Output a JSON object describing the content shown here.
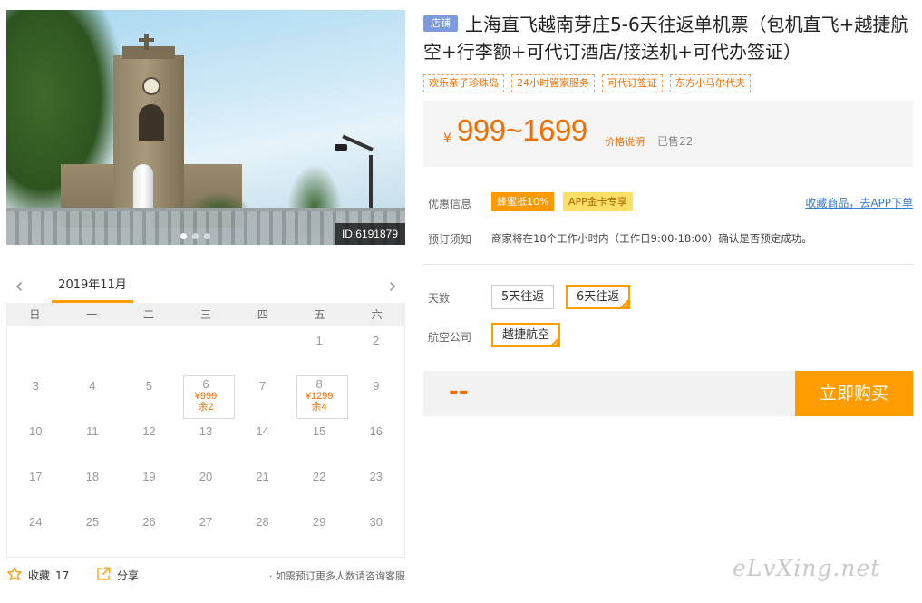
{
  "photo": {
    "id_label": "ID:6191879",
    "dots": 3,
    "active_dot": 0
  },
  "calendar": {
    "month": "2019年11月",
    "prev_icon": "chevron-left-icon",
    "next_icon": "chevron-right-icon",
    "weekdays": [
      "日",
      "一",
      "二",
      "三",
      "四",
      "五",
      "六"
    ],
    "weeks": [
      [
        {
          "d": ""
        },
        {
          "d": ""
        },
        {
          "d": ""
        },
        {
          "d": ""
        },
        {
          "d": ""
        },
        {
          "d": "1"
        },
        {
          "d": "2"
        }
      ],
      [
        {
          "d": "3"
        },
        {
          "d": "4"
        },
        {
          "d": "5"
        },
        {
          "d": "6",
          "price": "¥999",
          "stock": "余2"
        },
        {
          "d": "7"
        },
        {
          "d": "8",
          "price": "¥1299",
          "stock": "余4"
        },
        {
          "d": "9"
        }
      ],
      [
        {
          "d": "10"
        },
        {
          "d": "11"
        },
        {
          "d": "12"
        },
        {
          "d": "13"
        },
        {
          "d": "14"
        },
        {
          "d": "15"
        },
        {
          "d": "16"
        }
      ],
      [
        {
          "d": "17"
        },
        {
          "d": "18"
        },
        {
          "d": "19"
        },
        {
          "d": "20"
        },
        {
          "d": "21"
        },
        {
          "d": "22"
        },
        {
          "d": "23"
        }
      ],
      [
        {
          "d": "24"
        },
        {
          "d": "25"
        },
        {
          "d": "26"
        },
        {
          "d": "27"
        },
        {
          "d": "28"
        },
        {
          "d": "29"
        },
        {
          "d": "30"
        }
      ]
    ]
  },
  "footer": {
    "favorite_label": "收藏",
    "favorite_count": "17",
    "share_label": "分享",
    "consult_text": "· 如需预订更多人数请咨询客服"
  },
  "product": {
    "shop_tag": "店铺",
    "title": "上海直飞越南芽庄5-6天往返单机票（包机直飞+越捷航空+行李额+可代订酒店/接送机+可代办签证）",
    "tags": [
      "欢乐亲子珍珠岛",
      "24小时管家服务",
      "可代订签证",
      "东方小马尔代夫"
    ]
  },
  "price": {
    "currency": "¥",
    "value": "999~1699",
    "note": "价格说明",
    "sold": "已售22"
  },
  "promo": {
    "label": "优惠信息",
    "badge1": "蜂蜜抵10%",
    "badge2": "APP金卡专享",
    "app_link": "收藏商品，去APP下单"
  },
  "notice": {
    "label": "预订须知",
    "text": "商家将在18个工作小时内（工作日9:00-18:00）确认是否预定成功。"
  },
  "options": {
    "days_label": "天数",
    "days": [
      "5天往返",
      "6天往返"
    ],
    "days_selected": 1,
    "airline_label": "航空公司",
    "airlines": [
      "越捷航空"
    ],
    "airline_selected": 0
  },
  "buy": {
    "total": "--",
    "button": "立即购买"
  },
  "watermark": "eLvXing.net",
  "colors": {
    "accent": "#ff9d00",
    "price": "#f06e00",
    "link": "#3a7bd5",
    "shop_tag": "#7d9bdc"
  }
}
